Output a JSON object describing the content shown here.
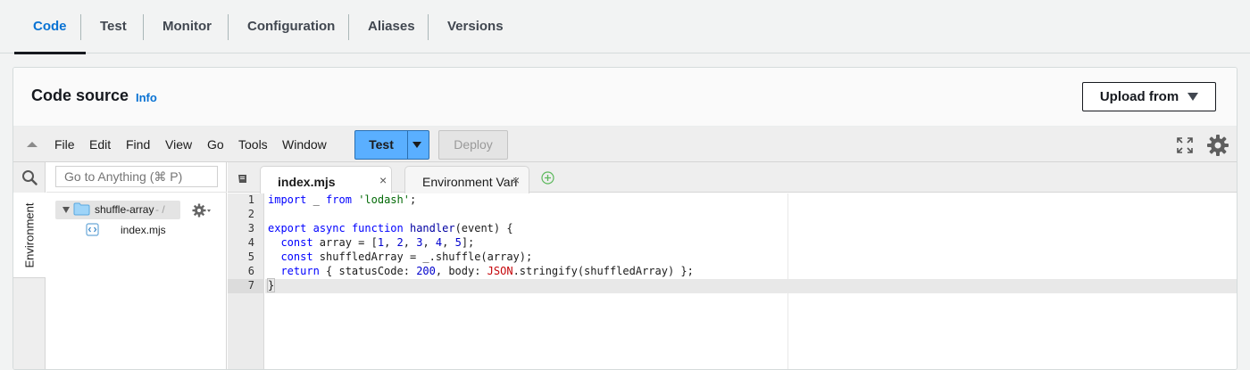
{
  "tabs": [
    {
      "label": "Code",
      "active": true
    },
    {
      "label": "Test"
    },
    {
      "label": "Monitor"
    },
    {
      "label": "Configuration"
    },
    {
      "label": "Aliases"
    },
    {
      "label": "Versions"
    }
  ],
  "panel": {
    "title": "Code source",
    "info": "Info",
    "upload_label": "Upload from"
  },
  "menu": {
    "items": [
      "File",
      "Edit",
      "Find",
      "View",
      "Go",
      "Tools",
      "Window"
    ],
    "test_label": "Test",
    "deploy_label": "Deploy"
  },
  "sidebar": {
    "environment_label": "Environment",
    "goto_placeholder": "Go to Anything (⌘ P)",
    "folder_name": "shuffle-array",
    "folder_path": "- /",
    "file_name": "index.mjs"
  },
  "editor": {
    "tabs": [
      "index.mjs",
      "Environment Vari"
    ],
    "close_glyph": "×",
    "line_numbers": [
      "1",
      "2",
      "3",
      "4",
      "5",
      "6",
      "7"
    ],
    "active_line": 7
  },
  "code_lines": [
    "import _ from 'lodash';",
    "",
    "export async function handler(event) {",
    "  const array = [1, 2, 3, 4, 5];",
    "  const shuffledArray = _.shuffle(array);",
    "  return { statusCode: 200, body: JSON.stringify(shuffledArray) };",
    "}"
  ],
  "colors": {
    "accent": "#0972d3",
    "test_button": "#5aafff",
    "keyword": "#0000ff",
    "string": "#036a07"
  },
  "icons": [
    "search-icon",
    "folder-icon",
    "gear-icon",
    "file-icon",
    "fullscreen-icon",
    "add-tab-icon",
    "tabs-menu-icon",
    "caret-down-icon"
  ]
}
